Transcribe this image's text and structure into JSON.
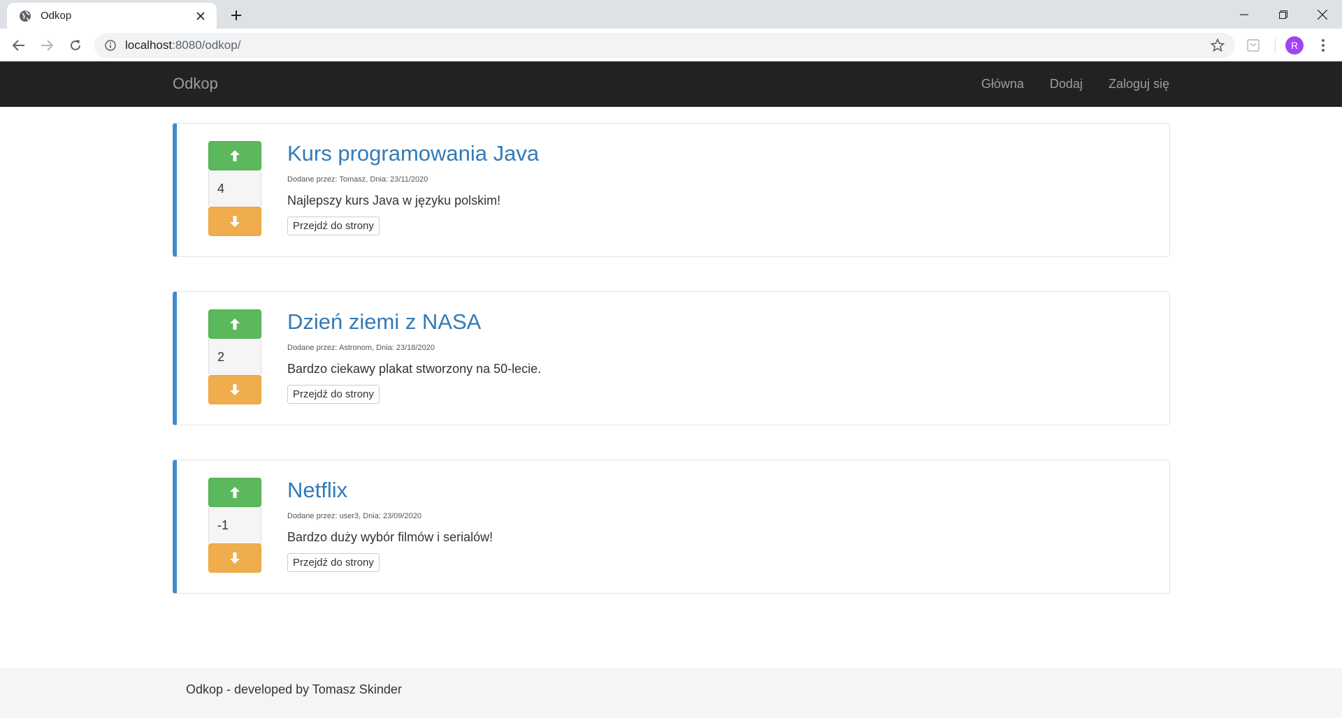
{
  "browser": {
    "tab_title": "Odkop",
    "url_host": "localhost",
    "url_rest": ":8080/odkop/",
    "profile_initial": "R"
  },
  "site": {
    "brand": "Odkop",
    "nav": [
      {
        "label": "Główna"
      },
      {
        "label": "Dodaj"
      },
      {
        "label": "Zaloguj się"
      }
    ]
  },
  "posts": [
    {
      "title": "Kurs programowania Java",
      "meta": "Dodane przez: Tomasz, Dnia: 23/11/2020",
      "description": "Najlepszy kurs Java w języku polskim!",
      "votes": "4",
      "button_label": "Przejdź do strony"
    },
    {
      "title": "Dzień ziemi z NASA",
      "meta": "Dodane przez: Astronom, Dnia: 23/18/2020",
      "description": "Bardzo ciekawy plakat stworzony na 50-lecie.",
      "votes": "2",
      "button_label": "Przejdź do strony"
    },
    {
      "title": "Netflix",
      "meta": "Dodane przez: user3, Dnia: 23/09/2020",
      "description": "Bardzo duży wybór filmów i serialów!",
      "votes": "-1",
      "button_label": "Przejdź do strony"
    }
  ],
  "footer": {
    "text": "Odkop - developed by Tomasz Skinder"
  },
  "colors": {
    "accent_border": "#428bca",
    "upvote": "#5cb85c",
    "downvote": "#f0ad4e",
    "navbar": "#222222",
    "link": "#337ab7"
  },
  "icons": {
    "upvote": "arrow-up-icon",
    "downvote": "arrow-down-icon"
  }
}
